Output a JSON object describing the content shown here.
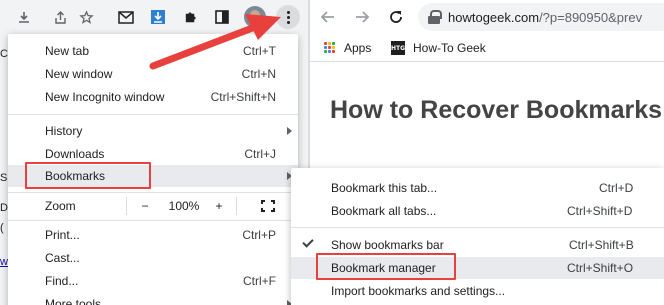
{
  "left_window": {
    "edge_texts": [
      "CI",
      "S",
      "Dv",
      "(",
      "w"
    ]
  },
  "right_window": {
    "url": "howtogeek.com/?p=890950&prev",
    "url_domain": "howtogeek.com",
    "url_rest": "/?p=890950&prev",
    "bookmarks_bar": [
      {
        "label": "Apps",
        "icon": "apps-grid-icon"
      },
      {
        "label": "How-To Geek",
        "icon": "htg-logo-icon"
      }
    ],
    "page_title": "How to Recover Bookmarks"
  },
  "main_menu": {
    "items": [
      {
        "label": "New tab",
        "shortcut": "Ctrl+T"
      },
      {
        "label": "New window",
        "shortcut": "Ctrl+N"
      },
      {
        "label": "New Incognito window",
        "shortcut": "Ctrl+Shift+N"
      },
      {
        "label": "History",
        "shortcut": "",
        "submenu": true
      },
      {
        "label": "Downloads",
        "shortcut": "Ctrl+J"
      },
      {
        "label": "Bookmarks",
        "shortcut": "",
        "submenu": true
      },
      {
        "label": "Print...",
        "shortcut": "Ctrl+P"
      },
      {
        "label": "Cast...",
        "shortcut": ""
      },
      {
        "label": "Find...",
        "shortcut": "Ctrl+F"
      },
      {
        "label": "More tools",
        "shortcut": "",
        "submenu": true
      }
    ],
    "zoom": {
      "label": "Zoom",
      "minus": "−",
      "value": "100%",
      "plus": "+"
    }
  },
  "bookmarks_submenu": {
    "items": [
      {
        "label": "Bookmark this tab...",
        "shortcut": "Ctrl+D"
      },
      {
        "label": "Bookmark all tabs...",
        "shortcut": "Ctrl+Shift+D"
      },
      {
        "label": "Show bookmarks bar",
        "shortcut": "Ctrl+Shift+B",
        "checked": true
      },
      {
        "label": "Bookmark manager",
        "shortcut": "Ctrl+Shift+O"
      },
      {
        "label": "Import bookmarks and settings...",
        "shortcut": ""
      }
    ]
  },
  "colors": {
    "annotation_red": "#e8403c",
    "menu_highlight": "#e8eaed",
    "toolbar_bg": "#f1f3f4"
  }
}
